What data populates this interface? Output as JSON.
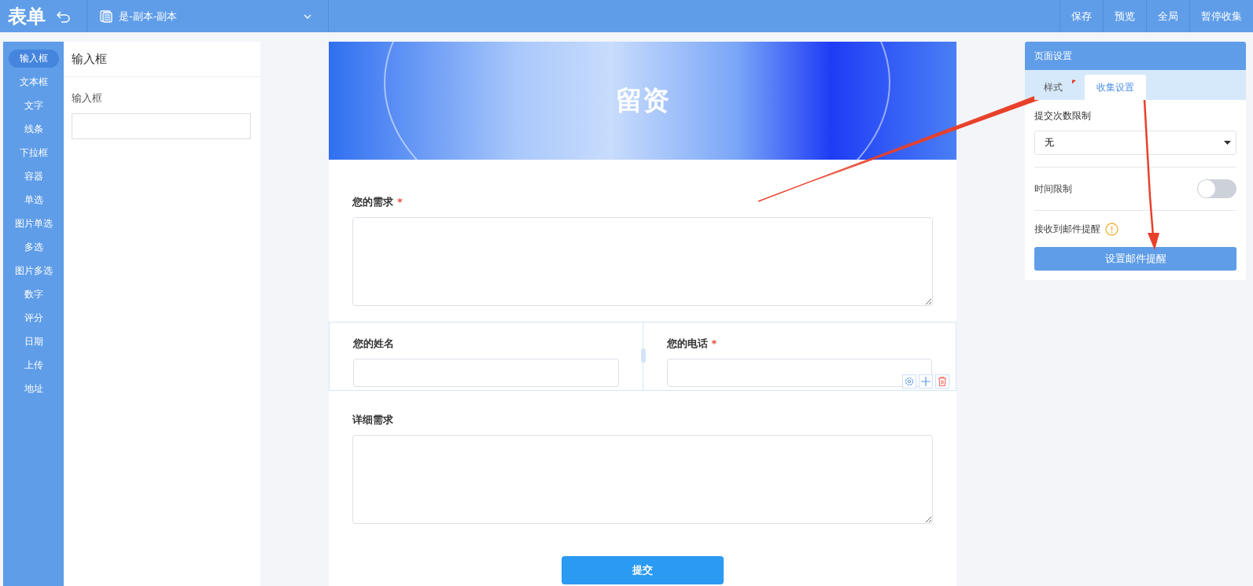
{
  "app": {
    "logo": "表单",
    "doc_title": "是-副本-副本",
    "actions": [
      "保存",
      "预览",
      "全局",
      "暂停收集"
    ]
  },
  "palette": [
    {
      "label": "输入框",
      "selected": true
    },
    {
      "label": "文本框",
      "selected": false
    },
    {
      "label": "文字",
      "selected": false
    },
    {
      "label": "线条",
      "selected": false
    },
    {
      "label": "下拉框",
      "selected": false
    },
    {
      "label": "容器",
      "selected": false
    },
    {
      "label": "单选",
      "selected": false
    },
    {
      "label": "图片单选",
      "selected": false
    },
    {
      "label": "多选",
      "selected": false
    },
    {
      "label": "图片多选",
      "selected": false
    },
    {
      "label": "数字",
      "selected": false
    },
    {
      "label": "评分",
      "selected": false
    },
    {
      "label": "日期",
      "selected": false
    },
    {
      "label": "上传",
      "selected": false
    },
    {
      "label": "地址",
      "selected": false
    }
  ],
  "properties": {
    "title": "输入框",
    "field_label": "输入框"
  },
  "form": {
    "title": "留资",
    "required_mark": "*",
    "fields": [
      {
        "kind": "textarea",
        "label": "您的需求",
        "required": true
      },
      {
        "kind": "row",
        "cells": [
          {
            "label": "您的姓名",
            "required": false
          },
          {
            "label": "您的电话",
            "required": true
          }
        ]
      },
      {
        "kind": "textarea",
        "label": "详细需求",
        "required": false
      }
    ],
    "submit": "提交"
  },
  "settings": {
    "title": "页面设置",
    "tabs": [
      {
        "label": "样式",
        "selected": false
      },
      {
        "label": "收集设置",
        "selected": true
      }
    ],
    "submit_limit": {
      "label": "提交次数限制",
      "value": "无"
    },
    "time_limit": {
      "label": "时间限制",
      "on": false
    },
    "email": {
      "label": "接收到邮件提醒",
      "button": "设置邮件提醒"
    }
  }
}
